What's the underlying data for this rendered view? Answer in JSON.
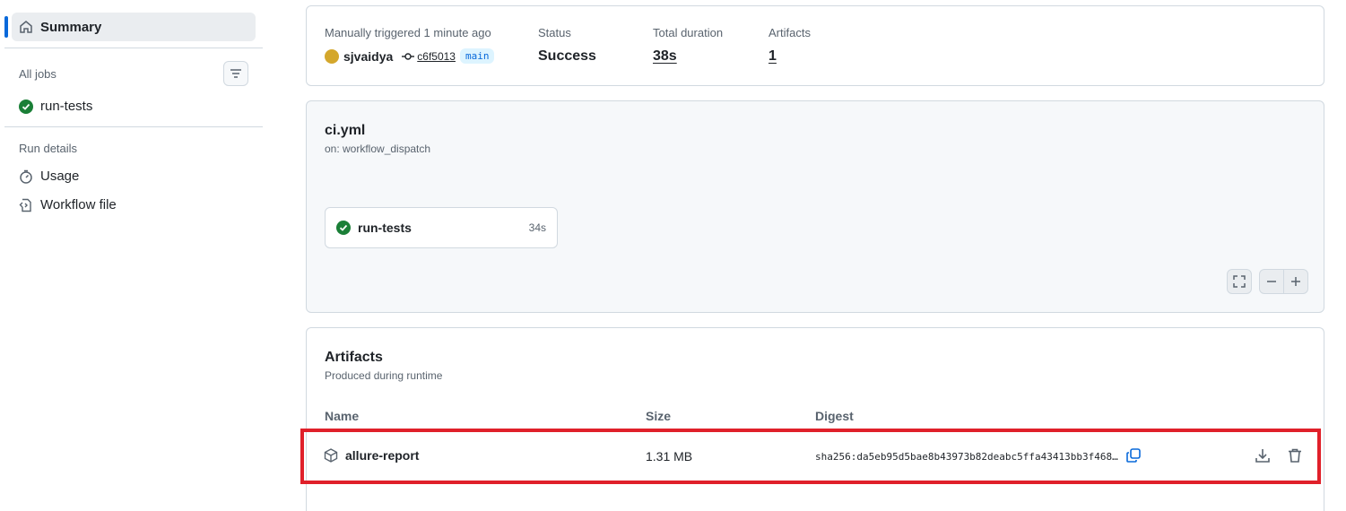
{
  "sidebar": {
    "summary_label": "Summary",
    "all_jobs_label": "All jobs",
    "jobs": [
      {
        "label": "run-tests",
        "status": "success"
      }
    ],
    "run_details_label": "Run details",
    "usage_label": "Usage",
    "workflow_file_label": "Workflow file"
  },
  "summary": {
    "trigger_label": "Manually triggered 1 minute ago",
    "actor": "sjvaidya",
    "commit": "c6f5013",
    "branch": "main",
    "status_label": "Status",
    "status_value": "Success",
    "duration_label": "Total duration",
    "duration_value": "38s",
    "artifacts_label": "Artifacts",
    "artifacts_value": "1"
  },
  "workflow": {
    "file": "ci.yml",
    "trigger": "on: workflow_dispatch",
    "job_name": "run-tests",
    "job_duration": "34s"
  },
  "artifacts": {
    "title": "Artifacts",
    "subtitle": "Produced during runtime",
    "columns": {
      "name": "Name",
      "size": "Size",
      "digest": "Digest"
    },
    "rows": [
      {
        "name": "allure-report",
        "size": "1.31 MB",
        "digest": "sha256:da5eb95d5bae8b43973b82deabc5ffa43413bb3f468…"
      }
    ]
  },
  "colors": {
    "accent": "#0969da",
    "success": "#1a7f37",
    "highlight": "#e0202a"
  }
}
